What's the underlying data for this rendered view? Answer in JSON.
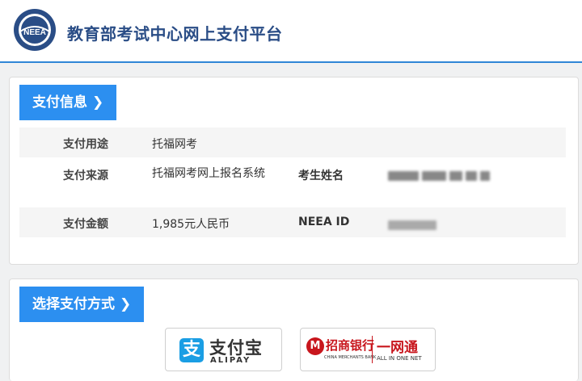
{
  "header": {
    "logo_text": "NEEA",
    "site_title": "教育部考试中心网上支付平台"
  },
  "payment_info": {
    "section_title": "支付信息",
    "arrow": "❯",
    "rows": [
      {
        "label": "支付用途",
        "value": "托福网考"
      },
      {
        "label": "支付来源",
        "value": "托福网考网上报名系统",
        "label2": "考生姓名"
      },
      {
        "label": "支付金额",
        "value": "1,985元人民币",
        "label2": "NEEA ID"
      }
    ]
  },
  "payment_method": {
    "section_title": "选择支付方式",
    "arrow": "❯",
    "alipay": {
      "logo_char": "支",
      "name": "支付宝",
      "en": "ALIPAY"
    },
    "cmb": {
      "logo_char": "M",
      "name": "招商银行",
      "en": "CHINA MERCHANTS BANK",
      "service_name": "一网通",
      "service_en": "ALL IN ONE NET"
    }
  },
  "colors": {
    "accent": "#2c8ff0",
    "title": "#2a4d86",
    "header_rule": "#2f86d6",
    "alipay_blue": "#1a9ee4",
    "cmb_red": "#c8161d"
  }
}
